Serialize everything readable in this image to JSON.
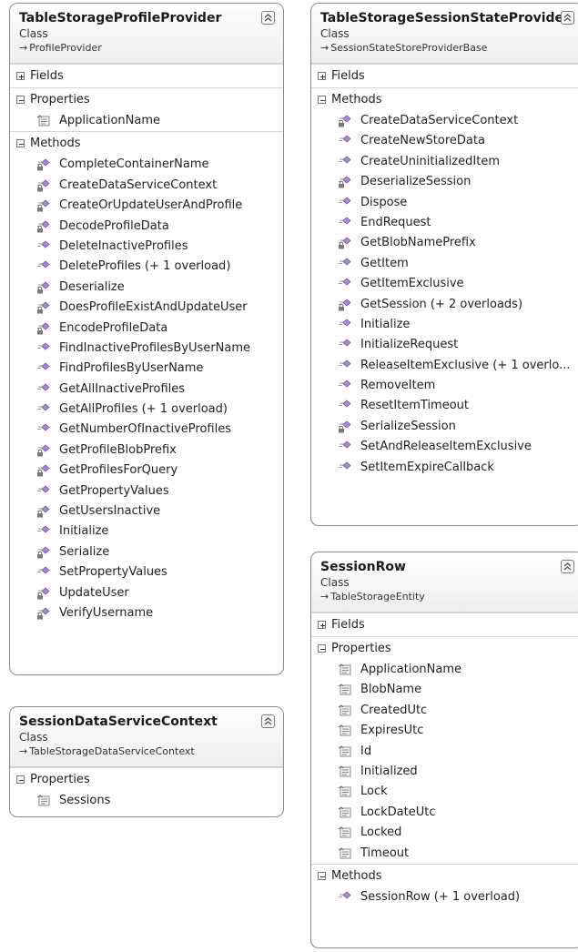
{
  "colors": {
    "border": "#8a8a8a",
    "method_icon": "#a98bd1",
    "private_lock": "#7a7a7a",
    "property_icon": "#8a8a8a"
  },
  "cards": {
    "profile_provider": {
      "title": "TableStorageProfileProvider",
      "kind": "Class",
      "base": "ProfileProvider",
      "fields_label": "Fields",
      "properties_label": "Properties",
      "properties": [
        "ApplicationName"
      ],
      "methods_label": "Methods",
      "methods": [
        {
          "name": "CompleteContainerName",
          "access": "private"
        },
        {
          "name": "CreateDataServiceContext",
          "access": "private"
        },
        {
          "name": "CreateOrUpdateUserAndProfile",
          "access": "private"
        },
        {
          "name": "DecodeProfileData",
          "access": "private"
        },
        {
          "name": "DeleteInactiveProfiles",
          "access": "public"
        },
        {
          "name": "DeleteProfiles (+ 1 overload)",
          "access": "public"
        },
        {
          "name": "Deserialize",
          "access": "private"
        },
        {
          "name": "DoesProfileExistAndUpdateUser",
          "access": "private"
        },
        {
          "name": "EncodeProfileData",
          "access": "private"
        },
        {
          "name": "FindInactiveProfilesByUserName",
          "access": "public"
        },
        {
          "name": "FindProfilesByUserName",
          "access": "public"
        },
        {
          "name": "GetAllInactiveProfiles",
          "access": "public"
        },
        {
          "name": "GetAllProfiles (+ 1 overload)",
          "access": "public"
        },
        {
          "name": "GetNumberOfInactiveProfiles",
          "access": "public"
        },
        {
          "name": "GetProfileBlobPrefix",
          "access": "private"
        },
        {
          "name": "GetProfilesForQuery",
          "access": "private"
        },
        {
          "name": "GetPropertyValues",
          "access": "public"
        },
        {
          "name": "GetUsersInactive",
          "access": "private"
        },
        {
          "name": "Initialize",
          "access": "public"
        },
        {
          "name": "Serialize",
          "access": "private"
        },
        {
          "name": "SetPropertyValues",
          "access": "public"
        },
        {
          "name": "UpdateUser",
          "access": "private"
        },
        {
          "name": "VerifyUsername",
          "access": "private"
        }
      ]
    },
    "session_state_provider": {
      "title": "TableStorageSessionStateProvider",
      "kind": "Class",
      "base": "SessionStateStoreProviderBase",
      "fields_label": "Fields",
      "methods_label": "Methods",
      "methods": [
        {
          "name": "CreateDataServiceContext",
          "access": "private"
        },
        {
          "name": "CreateNewStoreData",
          "access": "public"
        },
        {
          "name": "CreateUninitializedItem",
          "access": "public"
        },
        {
          "name": "DeserializeSession",
          "access": "private"
        },
        {
          "name": "Dispose",
          "access": "public"
        },
        {
          "name": "EndRequest",
          "access": "public"
        },
        {
          "name": "GetBlobNamePrefix",
          "access": "private"
        },
        {
          "name": "GetItem",
          "access": "public"
        },
        {
          "name": "GetItemExclusive",
          "access": "public"
        },
        {
          "name": "GetSession (+ 2 overloads)",
          "access": "private"
        },
        {
          "name": "Initialize",
          "access": "public"
        },
        {
          "name": "InitializeRequest",
          "access": "public"
        },
        {
          "name": "ReleaseItemExclusive (+ 1 overlo...",
          "access": "public"
        },
        {
          "name": "RemoveItem",
          "access": "public"
        },
        {
          "name": "ResetItemTimeout",
          "access": "public"
        },
        {
          "name": "SerializeSession",
          "access": "private"
        },
        {
          "name": "SetAndReleaseItemExclusive",
          "access": "public"
        },
        {
          "name": "SetItemExpireCallback",
          "access": "public"
        }
      ]
    },
    "session_data_service_context": {
      "title": "SessionDataServiceContext",
      "kind": "Class",
      "base": "TableStorageDataServiceContext",
      "properties_label": "Properties",
      "properties": [
        "Sessions"
      ]
    },
    "session_row": {
      "title": "SessionRow",
      "kind": "Class",
      "base": "TableStorageEntity",
      "fields_label": "Fields",
      "properties_label": "Properties",
      "properties": [
        "ApplicationName",
        "BlobName",
        "CreatedUtc",
        "ExpiresUtc",
        "Id",
        "Initialized",
        "Lock",
        "LockDateUtc",
        "Locked",
        "Timeout"
      ],
      "methods_label": "Methods",
      "methods": [
        {
          "name": "SessionRow (+ 1 overload)",
          "access": "public"
        }
      ]
    }
  }
}
